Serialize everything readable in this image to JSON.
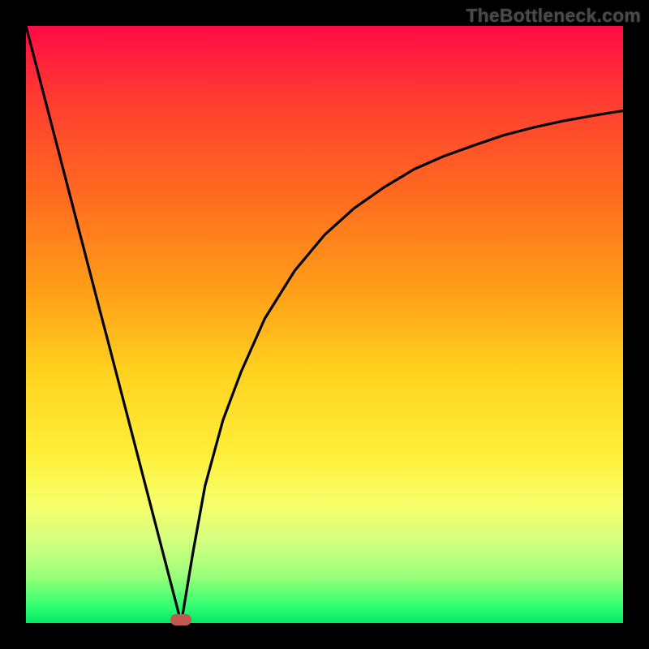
{
  "watermark": "TheBottleneck.com",
  "colors": {
    "frame": "#000000",
    "marker": "#c05a50",
    "curve": "#000000"
  },
  "chart_data": {
    "type": "line",
    "title": "",
    "xlabel": "",
    "ylabel": "",
    "xlim": [
      0,
      100
    ],
    "ylim": [
      0,
      100
    ],
    "grid": false,
    "series": [
      {
        "name": "left-branch",
        "x": [
          0,
          2,
          4,
          6,
          8,
          10,
          12,
          14,
          16,
          18,
          20,
          22,
          24,
          26
        ],
        "values": [
          100,
          92.3,
          84.6,
          76.9,
          69.2,
          61.5,
          53.8,
          46.2,
          38.5,
          30.8,
          23.1,
          15.4,
          7.7,
          0
        ]
      },
      {
        "name": "right-branch",
        "x": [
          26,
          28,
          30,
          33,
          36,
          40,
          45,
          50,
          55,
          60,
          65,
          70,
          75,
          80,
          85,
          90,
          95,
          100
        ],
        "values": [
          0,
          12,
          23,
          34,
          42,
          51,
          59,
          65,
          69.5,
          73,
          76,
          78.2,
          80,
          81.7,
          83,
          84.1,
          85,
          85.8
        ]
      }
    ],
    "annotations": [
      {
        "name": "minimum-marker",
        "x": 26,
        "y": 0.5
      }
    ]
  }
}
